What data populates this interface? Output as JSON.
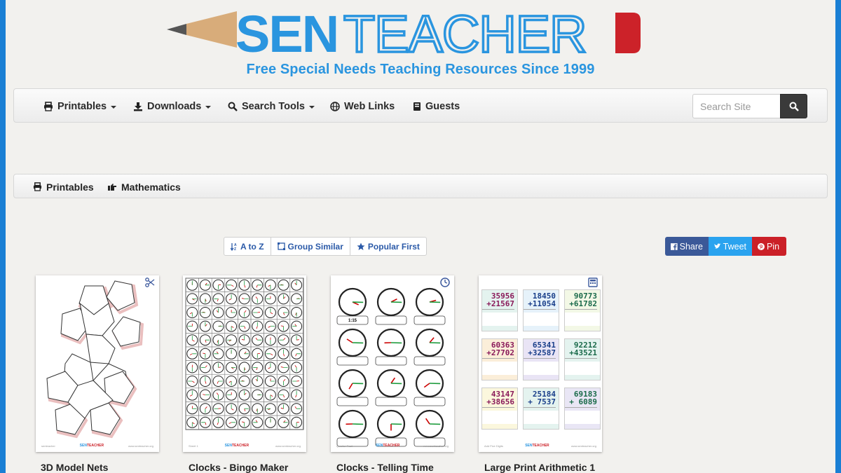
{
  "site": {
    "logo_text": "SENTEACHER",
    "tagline": "Free Special Needs Teaching Resources Since 1999",
    "colors": {
      "brand_blue": "#2a95df",
      "brand_red": "#cc2229",
      "frame_blue": "#1a7fd4"
    }
  },
  "nav": {
    "items": [
      {
        "label": "Printables",
        "icon": "printer-icon",
        "dropdown": true
      },
      {
        "label": "Downloads",
        "icon": "download-icon",
        "dropdown": true
      },
      {
        "label": "Search Tools",
        "icon": "search-icon",
        "dropdown": true
      },
      {
        "label": "Web Links",
        "icon": "globe-icon",
        "dropdown": false
      },
      {
        "label": "Guests",
        "icon": "book-icon",
        "dropdown": false
      }
    ],
    "search_placeholder": "Search Site"
  },
  "breadcrumb": [
    {
      "label": "Printables",
      "icon": "printer-icon"
    },
    {
      "label": "Mathematics",
      "icon": "hand-pointing-icon"
    }
  ],
  "sort": {
    "az": "A to Z",
    "group": "Group Similar",
    "popular": "Popular First"
  },
  "share": {
    "facebook": "Share",
    "twitter": "Tweet",
    "pinterest": "Pin"
  },
  "cards": [
    {
      "title": "3D Model Nets",
      "badge": "scissors-icon"
    },
    {
      "title": "Clocks - Bingo Maker",
      "badge": ""
    },
    {
      "title": "Clocks - Telling Time",
      "badge": "clock-icon"
    },
    {
      "title": "Large Print Arithmetic 1",
      "badge": "calculator-icon"
    }
  ],
  "thumb_clock_label": "1:15",
  "arithmetic": [
    {
      "a": "35956",
      "b": "+21567",
      "color": "#e4f3ef"
    },
    {
      "a": "18450",
      "b": "+11054",
      "color": "#e6f2fa"
    },
    {
      "a": "90773",
      "b": "+61782",
      "color": "#f3f8e6"
    },
    {
      "a": "60363",
      "b": "+27702",
      "color": "#fbeed9"
    },
    {
      "a": "65341",
      "b": "+32587",
      "color": "#e9e4f5"
    },
    {
      "a": "92212",
      "b": "+43521",
      "color": "#e4f3ef"
    },
    {
      "a": "43147",
      "b": "+38656",
      "color": "#fbf7dd"
    },
    {
      "a": "25184",
      "b": "+ 7537",
      "color": "#e4f3ef"
    },
    {
      "a": "69183",
      "b": "+ 6089",
      "color": "#e9e6f5"
    }
  ]
}
